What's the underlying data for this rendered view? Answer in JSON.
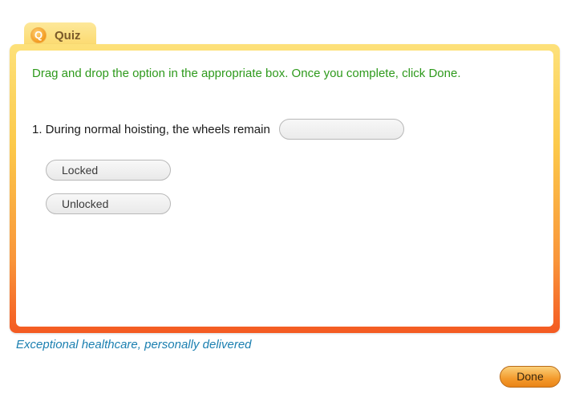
{
  "tab": {
    "icon": "quiz-q-icon",
    "icon_glyph": "Q",
    "label": "Quiz"
  },
  "instruction": "Drag and drop the option in the appropriate box. Once you complete, click Done.",
  "question": {
    "text": "1. During normal hoisting, the wheels remain",
    "drop_value": ""
  },
  "options": [
    {
      "label": "Locked"
    },
    {
      "label": "Unlocked"
    }
  ],
  "footer": {
    "tagline": "Exceptional healthcare, personally delivered",
    "done_label": "Done"
  },
  "colors": {
    "instruction": "#2e9a1c",
    "tagline": "#1a7fb0",
    "frame_top": "#fde17a",
    "frame_bottom": "#f45a22",
    "done_button": "#f39a2c"
  }
}
